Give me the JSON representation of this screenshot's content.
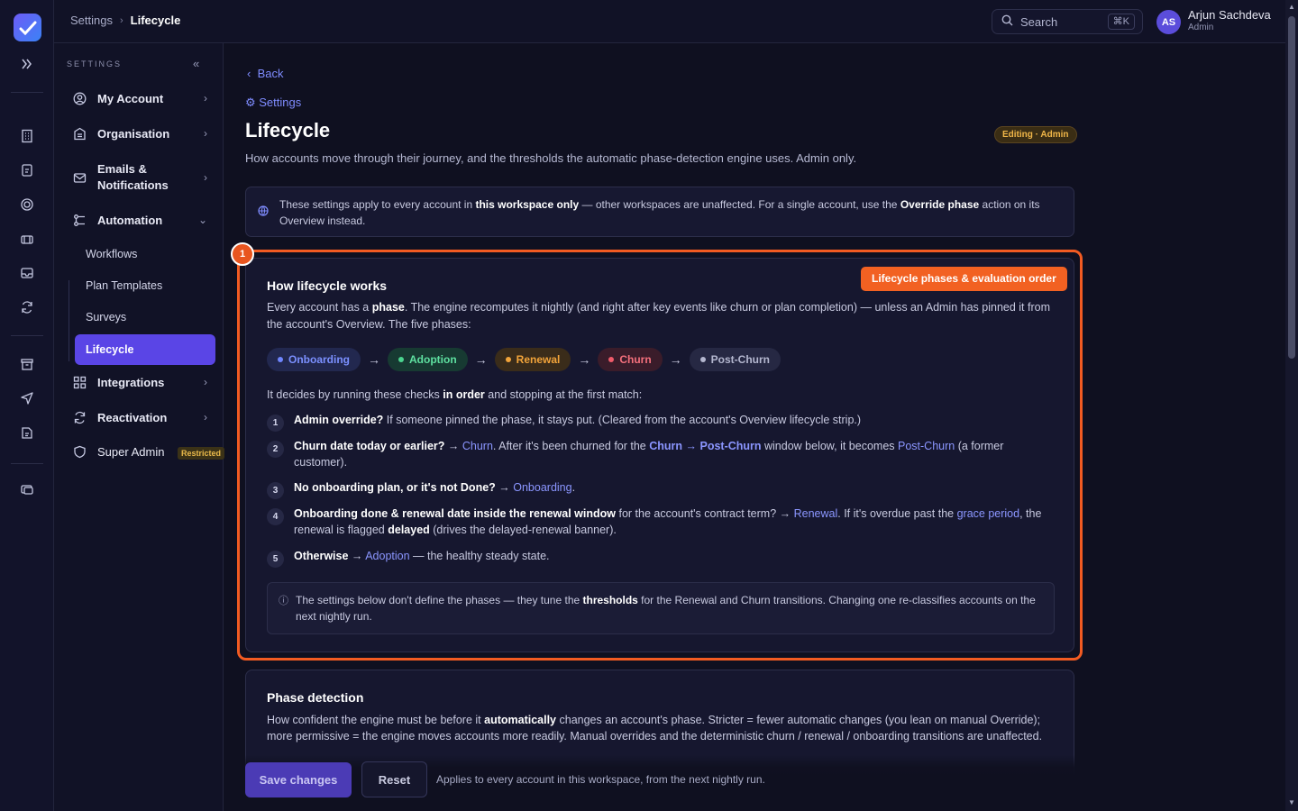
{
  "colors": {
    "accent": "#5a45e6",
    "link": "#8b96ff",
    "highlight": "#f25b22",
    "onboarding": "#6f86ff",
    "adoption": "#4bd48f",
    "renewal": "#f2a43a",
    "churn": "#f05b6a",
    "post_churn": "#b4b7cf"
  },
  "topbar": {
    "breadcrumb_parent": "Settings",
    "breadcrumb_current": "Lifecycle",
    "search_placeholder": "Search",
    "search_shortcut": "⌘K",
    "user_initials": "AS",
    "user_name": "Arjun Sachdeva",
    "user_role": "Admin"
  },
  "sidebar": {
    "heading": "SETTINGS",
    "items": [
      {
        "label": "My Account",
        "icon": "user-circle-icon"
      },
      {
        "label": "Organisation",
        "icon": "building-icon"
      },
      {
        "label": "Emails & Notifications",
        "icon": "mail-icon"
      },
      {
        "label": "Automation",
        "icon": "automation-icon"
      },
      {
        "label": "Integrations",
        "icon": "grid-icon"
      },
      {
        "label": "Reactivation",
        "icon": "refresh-icon"
      },
      {
        "label": "Super Admin",
        "icon": "shield-icon"
      }
    ],
    "automation_subitems": [
      "Workflows",
      "Plan Templates",
      "Surveys",
      "Lifecycle"
    ],
    "super_admin_badge": "Restricted"
  },
  "main": {
    "back_label": "Back",
    "settings_link": "⚙ Settings",
    "title": "Lifecycle",
    "edit_badge": "Editing · Admin",
    "subtitle": "How accounts move through their journey, and the thresholds the automatic phase-detection engine uses. Admin only.",
    "workspace_note": {
      "t1": "These settings apply to every account in ",
      "b1": "this workspace only",
      "t2": " — other workspaces are unaffected. For a single account, use the ",
      "b2": "Override phase",
      "t3": " action on its Overview instead."
    },
    "annotation_number": "1",
    "how_card": {
      "title": "How lifecycle works",
      "phases_button": "Lifecycle phases & evaluation order",
      "lead_t1": "Every account has a ",
      "lead_b1": "phase",
      "lead_t2": ". The engine recomputes it nightly (and right after key events like churn or plan completion) — unless an Admin has pinned it from the account's Overview. The five phases:",
      "phases": [
        "Onboarding",
        "Adoption",
        "Renewal",
        "Churn",
        "Post-Churn"
      ],
      "arrow": "→",
      "decides_t1": "It decides by running these checks ",
      "decides_b1": "in order",
      "decides_t2": " and stopping at the first match:",
      "steps": [
        {
          "n": "1",
          "b": "Admin override?",
          "t": " If someone pinned the phase, it stays put. (Cleared from the account's Overview lifecycle strip.)"
        },
        {
          "n": "2",
          "b": "Churn date today or earlier?",
          "t1": " → ",
          "l1": "Churn",
          "t2": ". After it's been churned for the ",
          "l2": "Churn → Post-Churn",
          "t3": " window below, it becomes ",
          "l3": "Post-Churn",
          "t4": " (a former customer)."
        },
        {
          "n": "3",
          "b": "No onboarding plan, or it's not Done?",
          "t1": " → ",
          "l1": "Onboarding",
          "t2": "."
        },
        {
          "n": "4",
          "b": "Onboarding done & renewal date inside the renewal window",
          "t1": " for the account's contract term? → ",
          "l1": "Renewal",
          "t2": ". If it's overdue past the ",
          "l2": "grace period",
          "t3": ", the renewal is flagged ",
          "b2": "delayed",
          "t4": " (drives the delayed-renewal banner)."
        },
        {
          "n": "5",
          "b": "Otherwise",
          "t1": " → ",
          "l1": "Adoption",
          "t2": " — the healthy steady state."
        }
      ],
      "info_t1": "The settings below don't define the phases — they tune the ",
      "info_b1": "thresholds",
      "info_t2": " for the Renewal and Churn transitions. Changing one re-classifies accounts on the next nightly run."
    },
    "phase_detection": {
      "title": "Phase detection",
      "t1": "How confident the engine must be before it ",
      "b1": "automatically",
      "t2": " changes an account's phase. Stricter = fewer automatic changes (you lean on manual Override); more permissive = the engine moves accounts more readily. Manual overrides and the deterministic churn / renewal / onboarding transitions are unaffected."
    },
    "footer": {
      "save_label": "Save changes",
      "reset_label": "Reset",
      "note": "Applies to every account in this workspace, from the next nightly run."
    }
  }
}
